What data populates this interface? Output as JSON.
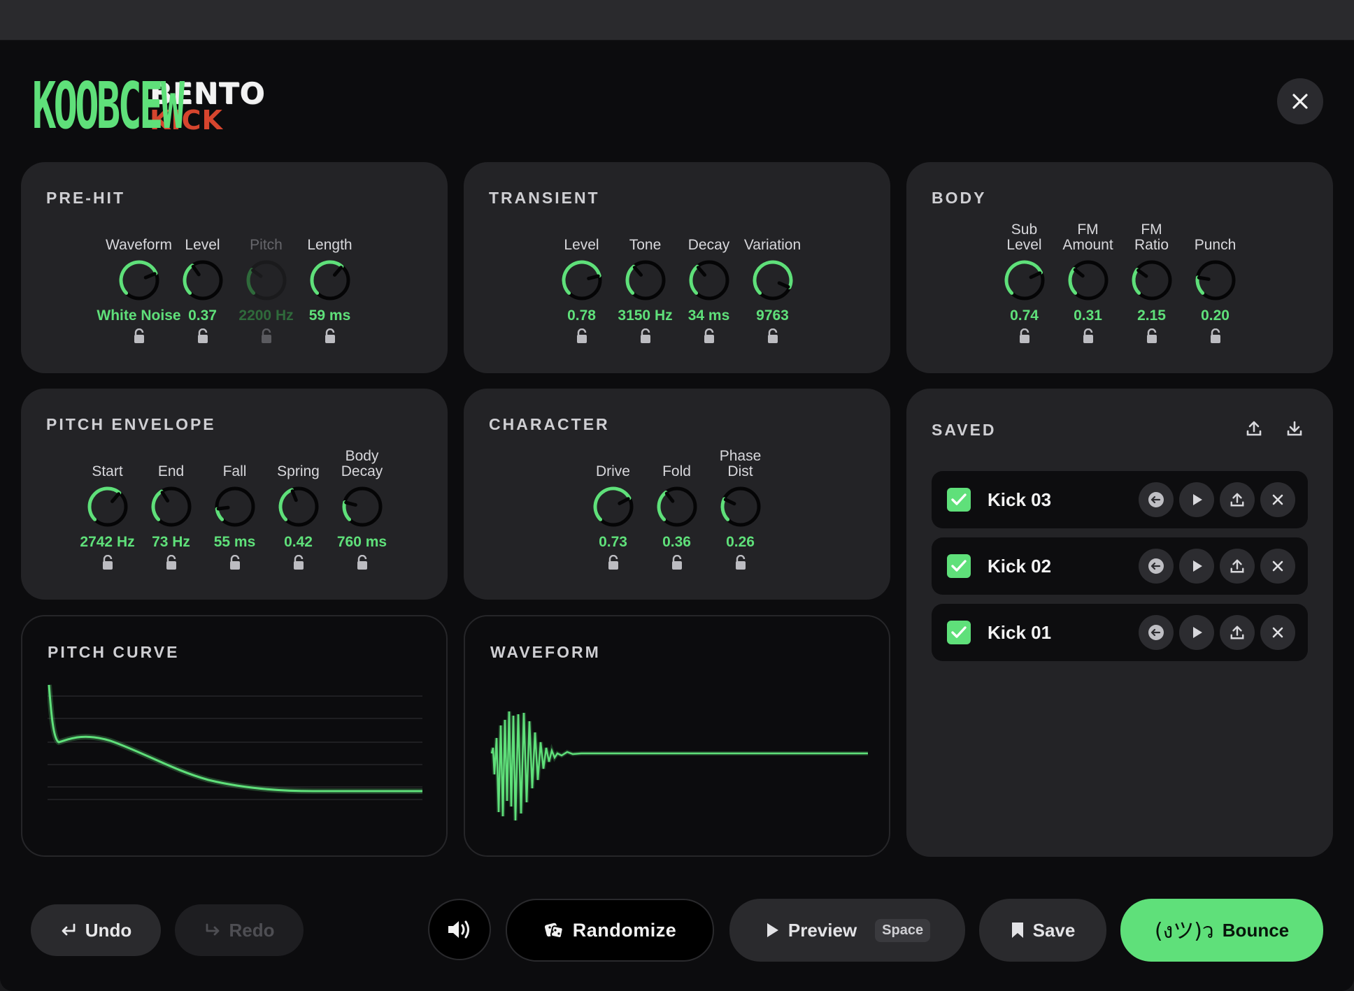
{
  "brand": {
    "logo_text": "KOOBCEW",
    "line1": "BENTO",
    "line2": "KICK"
  },
  "colors": {
    "accent": "#5fe07a",
    "danger": "#d6452e",
    "panel": "#232326",
    "background": "#0c0c0e"
  },
  "panels": {
    "prehit": {
      "title": "PRE-HIT",
      "knobs": [
        {
          "label": "Waveform",
          "value": "White Noise",
          "level": 0.75,
          "enabled": true
        },
        {
          "label": "Level",
          "value": "0.37",
          "level": 0.37,
          "enabled": true
        },
        {
          "label": "Pitch",
          "value": "2200 Hz",
          "level": 0.3,
          "enabled": false
        },
        {
          "label": "Length",
          "value": "59 ms",
          "level": 0.65,
          "enabled": true
        }
      ]
    },
    "transient": {
      "title": "TRANSIENT",
      "knobs": [
        {
          "label": "Level",
          "value": "0.78",
          "level": 0.78,
          "enabled": true
        },
        {
          "label": "Tone",
          "value": "3150 Hz",
          "level": 0.35,
          "enabled": true
        },
        {
          "label": "Decay",
          "value": "34 ms",
          "level": 0.35,
          "enabled": true
        },
        {
          "label": "Variation",
          "value": "9763",
          "level": 0.92,
          "enabled": true
        }
      ]
    },
    "body": {
      "title": "BODY",
      "knobs": [
        {
          "label": "Sub\nLevel",
          "value": "0.74",
          "level": 0.74,
          "enabled": true
        },
        {
          "label": "FM\nAmount",
          "value": "0.31",
          "level": 0.31,
          "enabled": true
        },
        {
          "label": "FM\nRatio",
          "value": "2.15",
          "level": 0.3,
          "enabled": true
        },
        {
          "label": "Punch",
          "value": "0.20",
          "level": 0.2,
          "enabled": true
        }
      ]
    },
    "pitch_envelope": {
      "title": "PITCH ENVELOPE",
      "knobs": [
        {
          "label": "Start",
          "value": "2742 Hz",
          "level": 0.65,
          "enabled": true
        },
        {
          "label": "End",
          "value": "73 Hz",
          "level": 0.38,
          "enabled": true
        },
        {
          "label": "Fall",
          "value": "55 ms",
          "level": 0.14,
          "enabled": true
        },
        {
          "label": "Spring",
          "value": "0.42",
          "level": 0.42,
          "enabled": true
        },
        {
          "label": "Body\nDecay",
          "value": "760 ms",
          "level": 0.22,
          "enabled": true
        }
      ]
    },
    "character": {
      "title": "CHARACTER",
      "knobs": [
        {
          "label": "Drive",
          "value": "0.73",
          "level": 0.73,
          "enabled": true
        },
        {
          "label": "Fold",
          "value": "0.36",
          "level": 0.36,
          "enabled": true
        },
        {
          "label": "Phase\nDist",
          "value": "0.26",
          "level": 0.26,
          "enabled": true
        }
      ]
    },
    "pitch_curve": {
      "title": "PITCH CURVE"
    },
    "waveform": {
      "title": "WAVEFORM"
    },
    "saved": {
      "title": "SAVED",
      "items": [
        {
          "name": "Kick 03",
          "checked": true
        },
        {
          "name": "Kick 02",
          "checked": true
        },
        {
          "name": "Kick 01",
          "checked": true
        }
      ]
    }
  },
  "footer": {
    "undo_label": "Undo",
    "redo_label": "Redo",
    "randomize_label": "Randomize",
    "preview_label": "Preview",
    "preview_shortcut": "Space",
    "save_label": "Save",
    "bounce_face": "(งツ)ว",
    "bounce_label": "Bounce"
  }
}
